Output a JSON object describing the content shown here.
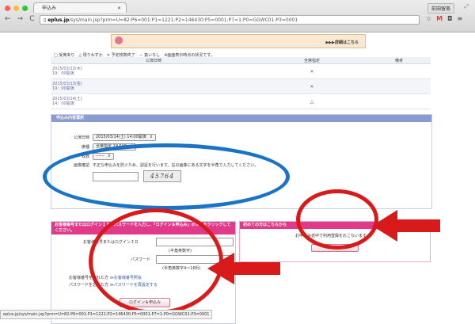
{
  "browser": {
    "tab_title": "申込み",
    "profile_label": "前田留美",
    "url_host": "eplus.jp",
    "url_path": "/sys/main.jsp?prm=U=82:P6=001:P1=1221:P2=146430:P5=0001:P7=1:P0=GGWC01:P3=0001",
    "status_url": "eplus.jp/sys/main.jsp?prm=U=82:P6=001:P1=1221:P2=146430:P5=0001:P7=1:P0=GGWC01:P3=0001"
  },
  "banner": {
    "details_link": "▶▶▶詳細はこちら"
  },
  "legend_text": "□ 受席あり　△ 残りわずか　× 予定枚数終了　－ 扱いなし　※画面表示時点の状況です。",
  "schedule": {
    "headers": [
      "公演日時",
      "全席指定",
      "備考"
    ],
    "rows": [
      {
        "date": "2015/03/12(木)",
        "time": "19：00開演",
        "status": "×"
      },
      {
        "date": "2015/03/13(金)",
        "time": "19：00開演",
        "status": "×"
      },
      {
        "date": "2015/03/14(土)",
        "time": "14：00開演",
        "status": "△"
      }
    ]
  },
  "order_form": {
    "title": "申込み内容選択",
    "date_label": "公演日時",
    "date_value": "2015/03/14(土) 14:00開演",
    "seat_label": "席種",
    "seat_value": "全席指定 19,500",
    "count_label": "枚数",
    "count_value": "------",
    "captcha_label": "画像確認",
    "captcha_note": "不正な申込みを防ぐため、認証を行います。右の画像にある文字を半角で入力してください。",
    "captcha_image_text": "45764"
  },
  "login_panel": {
    "title": "お客様番号またはログインＩＤ、パスワードを入力し、「ログイン＆申込み」ボタンをクリックしてください。",
    "id_label": "お客様番号またはログインＩＤ",
    "id_hint": "(半角英数字)",
    "password_label": "パスワード",
    "password_hint": "(半角英数字4～16桁)",
    "forgot_number_prefix": "お客様番号を忘れた方",
    "forgot_number_link": "≫お客様番号照会",
    "forgot_password_prefix": "パスワードを忘れた方",
    "forgot_password_link": "≫パスワードを再設定する",
    "login_button": "ログイン＆申込み"
  },
  "first_panel": {
    "title": "初めての方はこちらから",
    "note": "お申込み途中で利用登録をおこないます。",
    "button": "申込み"
  },
  "colors": {
    "annotation_blue": "#1a73c4",
    "annotation_red": "#d91a1a",
    "pink_accent": "#e23a8a",
    "form_header": "#8a9ccf"
  }
}
